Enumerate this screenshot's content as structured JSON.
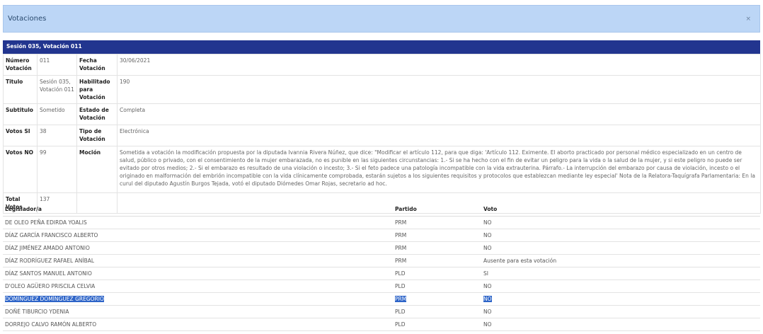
{
  "modal": {
    "title": "Votaciones",
    "close": "×"
  },
  "session": {
    "heading": "Sesión 035, Votación 011"
  },
  "details": {
    "numero_label": "Número Votación",
    "numero": "011",
    "fecha_label": "Fecha Votación",
    "fecha": "30/06/2021",
    "titulo_label": "Titulo",
    "titulo": "Sesión 035, Votación 011",
    "habilitado_label": "Habilitado para Votación",
    "habilitado": "190",
    "subtitulo_label": "Subtitulo",
    "subtitulo": "Sometido",
    "estado_label": "Estado de Votación",
    "estado": "Completa",
    "votos_si_label": "Votos SI",
    "votos_si": "38",
    "tipo_label": "Tipo de Votación",
    "tipo": "Electrónica",
    "votos_no_label": "Votos NO",
    "votos_no": "99",
    "mocion_label": "Moción",
    "mocion": "Sometida a votación la modificación propuesta por la diputada Ivannia Rivera Núñez, que dice: \"Modificar el artículo 112, para que diga: 'Artículo 112. Eximente. El aborto practicado por personal médico especializado en un centro de salud, público o privado, con el consentimiento de la mujer embarazada, no es punible en las siguientes circunstancias: 1.- Si se ha hecho con el fin de evitar un peligro para la vida o la salud de la mujer, y si este peligro no puede ser evitado por otros medios; 2.- Si el embarazo es resultado de una violación o incesto; 3.- Si el feto padece una patología incompatible con la vida extrauterina. Párrafo.- La interrupción del embarazo por causa de violación, incesto o el originado en malformación del embrión incompatible con la vida clínicamente comprobada, estarán sujetos a los siguientes requisitos y protocolos que establezcan mediante ley especial' Nota de la Relatora-Taquígrafa Parlamentaria: En la curul del diputado Agustín Burgos Tejada, votó el diputado Diómedes Omar Rojas, secretario ad hoc.",
    "total_label": "Total Votos",
    "total": "137"
  },
  "votes": {
    "headers": {
      "legislador": "Legislador/a",
      "partido": "Partido",
      "voto": "Voto"
    },
    "rows": [
      {
        "legislador": "DE OLEO PEÑA EDIRDA YOALIS",
        "partido": "PRM",
        "voto": "NO"
      },
      {
        "legislador": "DÍAZ GARCÍA FRANCISCO ALBERTO",
        "partido": "PRM",
        "voto": "NO"
      },
      {
        "legislador": "DÍAZ JIMÉNEZ AMADO ANTONIO",
        "partido": "PRM",
        "voto": "NO"
      },
      {
        "legislador": "DÍAZ RODRÍGUEZ RAFAEL ANÍBAL",
        "partido": "PRM",
        "voto": "Ausente para esta votación"
      },
      {
        "legislador": "DÍAZ SANTOS MANUEL ANTONIO",
        "partido": "PLD",
        "voto": "SI"
      },
      {
        "legislador": "D'OLEO AGÜERO PRISCILA CELVIA",
        "partido": "PLD",
        "voto": "NO"
      },
      {
        "legislador": "DOMÍNGUEZ DOMÍNGUEZ GREGORIO",
        "partido": "PRM",
        "voto": "NO"
      },
      {
        "legislador": "DOÑÉ TIBURCIO YDENIA",
        "partido": "PLD",
        "voto": "NO"
      },
      {
        "legislador": "DORREJO CALVO RAMÓN ALBERTO",
        "partido": "PLD",
        "voto": "NO"
      }
    ]
  }
}
